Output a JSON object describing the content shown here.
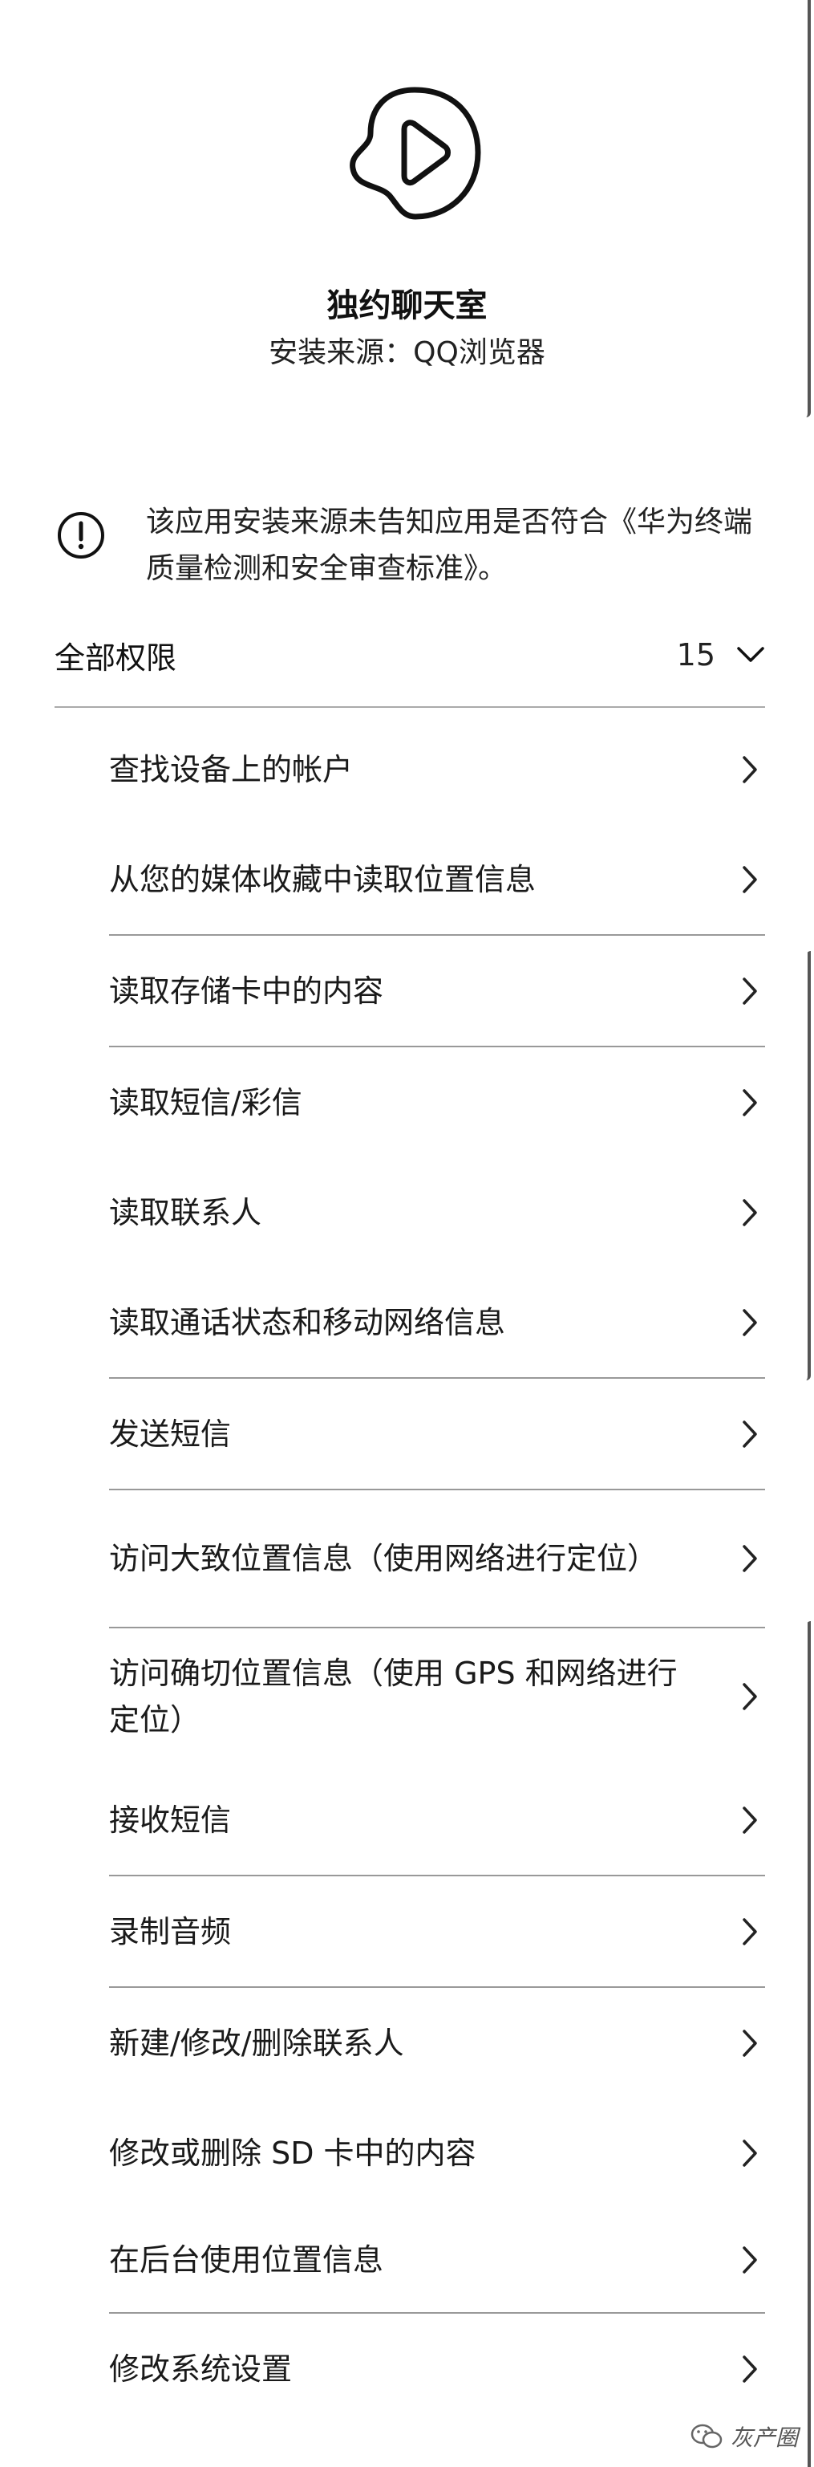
{
  "app": {
    "name": "独约聊天室",
    "install_source": "安装来源：QQ浏览器",
    "icon": "play-blob-icon"
  },
  "warning": {
    "icon": "exclamation-circle-icon",
    "text": "该应用安装来源未告知应用是否符合《华为终端质量检测和安全审查标准》。"
  },
  "permissions": {
    "title": "全部权限",
    "count": "15",
    "items": [
      {
        "label": "查找设备上的帐户"
      },
      {
        "label": "从您的媒体收藏中读取位置信息"
      },
      {
        "label": "读取存储卡中的内容"
      },
      {
        "label": "读取短信/彩信"
      },
      {
        "label": "读取联系人"
      },
      {
        "label": "读取通话状态和移动网络信息"
      },
      {
        "label": "发送短信"
      },
      {
        "label": "访问大致位置信息（使用网络进行定位）"
      },
      {
        "label": "访问确切位置信息（使用 GPS 和网络进行定位）"
      },
      {
        "label": "接收短信"
      },
      {
        "label": "录制音频"
      },
      {
        "label": "新建/修改/删除联系人"
      },
      {
        "label": "修改或删除 SD 卡中的内容"
      },
      {
        "label": "在后台使用位置信息"
      },
      {
        "label": "修改系统设置"
      }
    ]
  },
  "watermark": {
    "text": "灰产圈",
    "icon": "wechat-icon"
  }
}
